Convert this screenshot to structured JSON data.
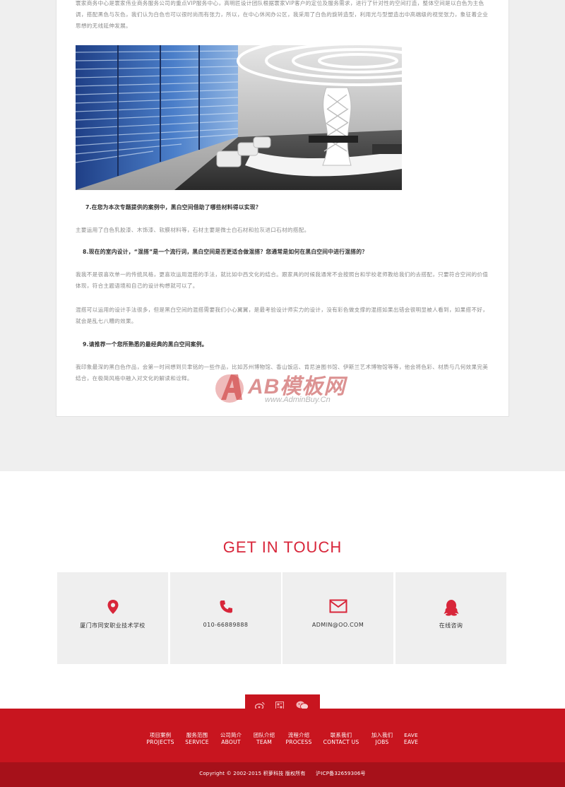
{
  "article": {
    "para_top": "寰家商务中心是寰家伟业商务服务公司的重点VIP服务中心，高明匠设计团队根据寰家VIP客户的定位及服务需求，进行了针对性的空间打造，整体空间是以白色为主色调，搭配黑色与灰色，我们认为白色也可以很时尚而有张力，所以，在中心休闲办公区，我采用了白色的旋转造型，利用光与型塑造出中高端级的视觉张力，象征着企业思想的无线延伸发展。",
    "photo_alt": "",
    "q7": "7.在您为本次专题提供的案例中，黑白空间借助了哪些材料得以实现？",
    "p7": "主要运用了白色乳胶漆、木饰漆、软膜材料等，石材主要是微士白石材和拉灰进口石材的搭配。",
    "q8": "8.现在的室内设计，“混搭”是一个流行词，黑白空间是否更适合做混搭？您通常是如何在黑白空间中进行混搭的？",
    "p8a": "我我不是很喜欢单一的传统风格，更喜欢运用混搭的手法，就比如中西文化的结合。跟家具的时候我通常不会按照台和学校老师教给我们的去搭配，只要符合空间的价值体现，符合主题语境和自己的设计构想就可以了。",
    "p8b": "混搭可以运用的设计手法很多，但是黑白空间的混搭需要我们小心翼翼，是最考验设计师实力的设计，没有彩色做支撑的混搭如果出错会很明显被人看到，如果搭不好，就会是乱七八糟的效果。",
    "q9": "9.请推荐一个您所熟悉的最经典的黑白空间案例。",
    "p9": "我印象最深的黑白色作品，会第一时间想到贝聿铭的一些作品，比如苏州博物馆、香山饭店、肯尼迪图书馆、伊斯兰艺术博物馆等等，他会将色彩、材质与几何效果完美结合，在极简风格中融入对文化的解读和诠释。"
  },
  "watermark": {
    "text": "AB模板网",
    "url": "www.AdminBuy.Cn"
  },
  "contact": {
    "title": "GET IN TOUCH",
    "items": [
      {
        "icon": "location-pin-icon",
        "label": "厦门市同安职业技术学校"
      },
      {
        "icon": "phone-icon",
        "label": "010-66889888"
      },
      {
        "icon": "mail-icon",
        "label": "ADMIN@OO.COM"
      },
      {
        "icon": "qq-icon",
        "label": "在线咨询"
      }
    ]
  },
  "footer": {
    "social": [
      "weibo-icon",
      "qrcode-icon",
      "wechat-icon"
    ],
    "nav": [
      {
        "zh": "项目案例",
        "en": "PROJECTS"
      },
      {
        "zh": "服务范围",
        "en": "SERVICE"
      },
      {
        "zh": "公司简介",
        "en": "ABOUT"
      },
      {
        "zh": "团队介绍",
        "en": "TEAM"
      },
      {
        "zh": "流程介绍",
        "en": "PROCESS"
      },
      {
        "zh": "联系我们",
        "en": "CONTACT US"
      },
      {
        "zh": "加入我们",
        "en": "JOBS"
      },
      {
        "zh": "EAVE",
        "en": "EAVE"
      }
    ],
    "copyright": "Copyright © 2002-2015 积萝科技 版权所有",
    "icp": "沪ICP备32659306号"
  },
  "colors": {
    "accent": "#d8263a",
    "footer_bg": "#c8151f",
    "footer_bottom": "#a6111a",
    "panel_bg": "#efefef"
  }
}
